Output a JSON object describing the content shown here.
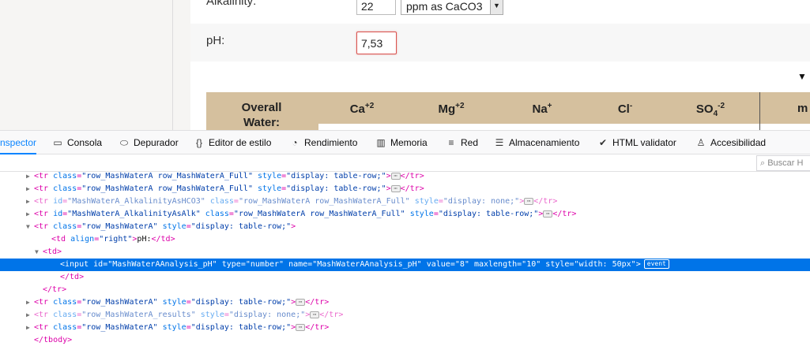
{
  "form": {
    "alkalinity_label": "Alkalinity:",
    "alkalinity_value": "22",
    "alkalinity_unit": "ppm as CaCO3",
    "ph_label": "pH:",
    "ph_value": "7,53"
  },
  "water_table": {
    "overall_line1": "Overall",
    "overall_line2": "Water:",
    "ions": [
      {
        "base": "Ca",
        "sup": "+2",
        "sub": ""
      },
      {
        "base": "Mg",
        "sup": "+2",
        "sub": ""
      },
      {
        "base": "Na",
        "sup": "+",
        "sub": ""
      },
      {
        "base": "Cl",
        "sup": "-",
        "sub": ""
      },
      {
        "base": "SO",
        "sub": "4",
        "sup": "-2"
      }
    ],
    "cut_header": "m"
  },
  "devtools": {
    "tabs": [
      {
        "label": "nspector",
        "icon": "inspector-icon",
        "glyph": ""
      },
      {
        "label": "Consola",
        "icon": "console-icon",
        "glyph": "▭"
      },
      {
        "label": "Depurador",
        "icon": "debugger-icon",
        "glyph": "⬭"
      },
      {
        "label": "Editor de estilo",
        "icon": "style-editor-icon",
        "glyph": "{}"
      },
      {
        "label": "Rendimiento",
        "icon": "performance-icon",
        "glyph": "◔"
      },
      {
        "label": "Memoria",
        "icon": "memory-icon",
        "glyph": "▥"
      },
      {
        "label": "Red",
        "icon": "network-icon",
        "glyph": "≡"
      },
      {
        "label": "Almacenamiento",
        "icon": "storage-icon",
        "glyph": "☰"
      },
      {
        "label": "HTML validator",
        "icon": "validator-icon",
        "glyph": "✔"
      },
      {
        "label": "Accesibilidad",
        "icon": "accessibility-icon",
        "glyph": "♙"
      }
    ],
    "search_placeholder": "Buscar H",
    "tree_lines": [
      {
        "indent": 3,
        "twisty": "▶",
        "parts": [
          [
            "tag",
            "<tr "
          ],
          [
            "an",
            "class"
          ],
          [
            "tag",
            "="
          ],
          [
            "av",
            "\"row_MashWaterA row_MashWaterA_Full\""
          ],
          [
            "tag",
            " "
          ],
          [
            "an",
            "style"
          ],
          [
            "tag",
            "="
          ],
          [
            "av",
            "\"display: table-row;\""
          ],
          [
            "tag",
            ">"
          ],
          [
            "ell",
            "⋯"
          ],
          [
            "tag",
            "</tr>"
          ]
        ]
      },
      {
        "indent": 3,
        "twisty": "▶",
        "parts": [
          [
            "tag",
            "<tr "
          ],
          [
            "an",
            "class"
          ],
          [
            "tag",
            "="
          ],
          [
            "av",
            "\"row_MashWaterA row_MashWaterA_Full\""
          ],
          [
            "tag",
            " "
          ],
          [
            "an",
            "style"
          ],
          [
            "tag",
            "="
          ],
          [
            "av",
            "\"display: table-row;\""
          ],
          [
            "tag",
            ">"
          ],
          [
            "ell",
            "⋯"
          ],
          [
            "tag",
            "</tr>"
          ]
        ]
      },
      {
        "indent": 3,
        "twisty": "▶",
        "dim": true,
        "parts": [
          [
            "tag",
            "<tr "
          ],
          [
            "an",
            "id"
          ],
          [
            "tag",
            "="
          ],
          [
            "av",
            "\"MashWaterA_AlkalinityAsHCO3\""
          ],
          [
            "tag",
            " "
          ],
          [
            "an",
            "class"
          ],
          [
            "tag",
            "="
          ],
          [
            "av",
            "\"row_MashWaterA row_MashWaterA_Full\""
          ],
          [
            "tag",
            " "
          ],
          [
            "an",
            "style"
          ],
          [
            "tag",
            "="
          ],
          [
            "av",
            "\"display: none;\""
          ],
          [
            "tag",
            ">"
          ],
          [
            "ell",
            "⋯"
          ],
          [
            "tag",
            "</tr>"
          ]
        ]
      },
      {
        "indent": 3,
        "twisty": "▶",
        "parts": [
          [
            "tag",
            "<tr "
          ],
          [
            "an",
            "id"
          ],
          [
            "tag",
            "="
          ],
          [
            "av",
            "\"MashWaterA_AlkalinityAsAlk\""
          ],
          [
            "tag",
            " "
          ],
          [
            "an",
            "class"
          ],
          [
            "tag",
            "="
          ],
          [
            "av",
            "\"row_MashWaterA row_MashWaterA_Full\""
          ],
          [
            "tag",
            " "
          ],
          [
            "an",
            "style"
          ],
          [
            "tag",
            "="
          ],
          [
            "av",
            "\"display: table-row;\""
          ],
          [
            "tag",
            ">"
          ],
          [
            "ell",
            "⋯"
          ],
          [
            "tag",
            "</tr>"
          ]
        ]
      },
      {
        "indent": 3,
        "twisty": "▼",
        "parts": [
          [
            "tag",
            "<tr "
          ],
          [
            "an",
            "class"
          ],
          [
            "tag",
            "="
          ],
          [
            "av",
            "\"row_MashWaterA\""
          ],
          [
            "tag",
            " "
          ],
          [
            "an",
            "style"
          ],
          [
            "tag",
            "="
          ],
          [
            "av",
            "\"display: table-row;\""
          ],
          [
            "tag",
            ">"
          ]
        ]
      },
      {
        "indent": 5,
        "twisty": "",
        "parts": [
          [
            "tag",
            "<td "
          ],
          [
            "an",
            "align"
          ],
          [
            "tag",
            "="
          ],
          [
            "av",
            "\"right\""
          ],
          [
            "tag",
            ">"
          ],
          [
            "txt",
            "pH:"
          ],
          [
            "tag",
            "</td>"
          ]
        ]
      },
      {
        "indent": 4,
        "twisty": "▼",
        "parts": [
          [
            "tag",
            "<td>"
          ]
        ]
      },
      {
        "indent": 6,
        "twisty": "",
        "sel": true,
        "badge": "event",
        "parts": [
          [
            "tag",
            "<input "
          ],
          [
            "an",
            "id"
          ],
          [
            "tag",
            "="
          ],
          [
            "av",
            "\"MashWaterAAnalysis_pH\""
          ],
          [
            "tag",
            " "
          ],
          [
            "an",
            "type"
          ],
          [
            "tag",
            "="
          ],
          [
            "av",
            "\"number\""
          ],
          [
            "tag",
            " "
          ],
          [
            "an",
            "name"
          ],
          [
            "tag",
            "="
          ],
          [
            "av",
            "\"MashWaterAAnalysis_pH\""
          ],
          [
            "tag",
            " "
          ],
          [
            "an",
            "value"
          ],
          [
            "tag",
            "="
          ],
          [
            "av",
            "\"8\""
          ],
          [
            "tag",
            " "
          ],
          [
            "an",
            "maxlength"
          ],
          [
            "tag",
            "="
          ],
          [
            "av",
            "\"10\""
          ],
          [
            "tag",
            " "
          ],
          [
            "an",
            "style"
          ],
          [
            "tag",
            "="
          ],
          [
            "av",
            "\"width: 50px\""
          ],
          [
            "tag",
            ">"
          ]
        ]
      },
      {
        "indent": 6,
        "twisty": "",
        "parts": [
          [
            "tag",
            "</td>"
          ]
        ]
      },
      {
        "indent": 4,
        "twisty": "",
        "parts": [
          [
            "tag",
            "</tr>"
          ]
        ]
      },
      {
        "indent": 3,
        "twisty": "▶",
        "parts": [
          [
            "tag",
            "<tr "
          ],
          [
            "an",
            "class"
          ],
          [
            "tag",
            "="
          ],
          [
            "av",
            "\"row_MashWaterA\""
          ],
          [
            "tag",
            " "
          ],
          [
            "an",
            "style"
          ],
          [
            "tag",
            "="
          ],
          [
            "av",
            "\"display: table-row;\""
          ],
          [
            "tag",
            ">"
          ],
          [
            "ell",
            "⋯"
          ],
          [
            "tag",
            "</tr>"
          ]
        ]
      },
      {
        "indent": 3,
        "twisty": "▶",
        "dim": true,
        "parts": [
          [
            "tag",
            "<tr "
          ],
          [
            "an",
            "class"
          ],
          [
            "tag",
            "="
          ],
          [
            "av",
            "\"row_MashWaterA_results\""
          ],
          [
            "tag",
            " "
          ],
          [
            "an",
            "style"
          ],
          [
            "tag",
            "="
          ],
          [
            "av",
            "\"display: none;\""
          ],
          [
            "tag",
            ">"
          ],
          [
            "ell",
            "⋯"
          ],
          [
            "tag",
            "</tr>"
          ]
        ]
      },
      {
        "indent": 3,
        "twisty": "▶",
        "parts": [
          [
            "tag",
            "<tr "
          ],
          [
            "an",
            "class"
          ],
          [
            "tag",
            "="
          ],
          [
            "av",
            "\"row_MashWaterA\""
          ],
          [
            "tag",
            " "
          ],
          [
            "an",
            "style"
          ],
          [
            "tag",
            "="
          ],
          [
            "av",
            "\"display: table-row;\""
          ],
          [
            "tag",
            ">"
          ],
          [
            "ell",
            "⋯"
          ],
          [
            "tag",
            "</tr>"
          ]
        ]
      },
      {
        "indent": 3,
        "twisty": "",
        "parts": [
          [
            "tag",
            "</tbody>"
          ]
        ]
      }
    ]
  },
  "colors": {
    "accent": "#0a84ff",
    "selection": "#0074e8",
    "invalid_border": "#d9534f",
    "table_header": "#d5c09e"
  }
}
